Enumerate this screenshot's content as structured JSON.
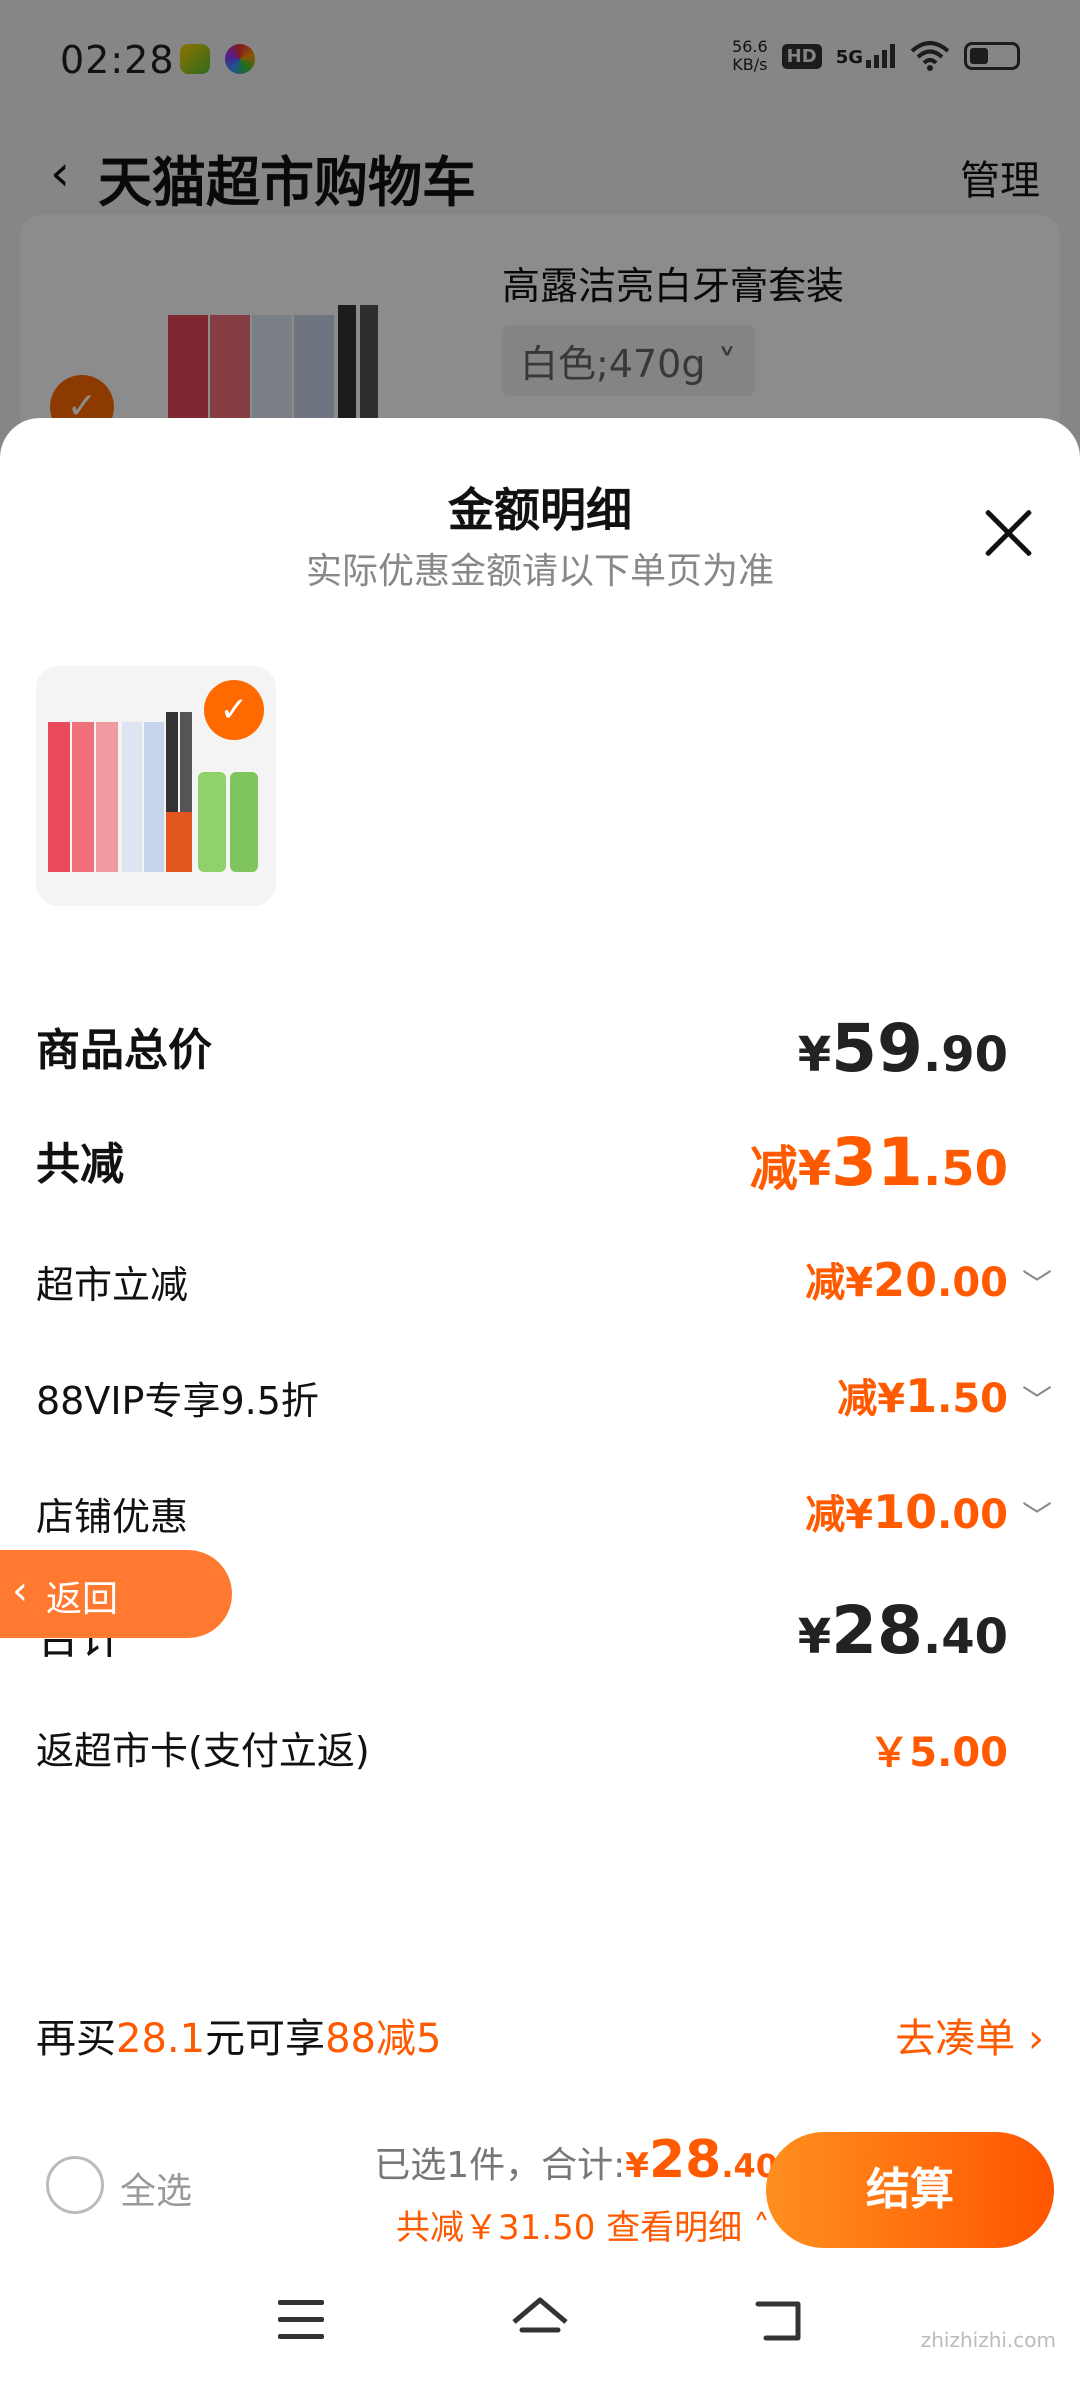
{
  "status_bar": {
    "time": "02:28",
    "net_speed_value": "56.6",
    "net_speed_unit": "KB/s",
    "hd_label": "HD",
    "signal_label": "5G"
  },
  "cart_page": {
    "title": "天猫超市购物车",
    "manage": "管理",
    "item_name": "高露洁亮白牙膏套装",
    "item_spec": "白色;470g ˅"
  },
  "sheet": {
    "title": "金额明细",
    "subtitle": "实际优惠金额请以下单页为准",
    "rows": [
      {
        "label": "商品总价",
        "prefix": "",
        "yen": "¥",
        "int": "59",
        "dec": ".90"
      },
      {
        "label": "共减",
        "prefix": "减",
        "yen": "¥",
        "int": "31",
        "dec": ".50"
      },
      {
        "label": "超市立减",
        "prefix": "减",
        "yen": "¥",
        "int": "20",
        "dec": ".00"
      },
      {
        "label": "88VIP专享9.5折",
        "prefix": "减",
        "yen": "¥",
        "int": "1",
        "dec": ".50"
      },
      {
        "label": "店铺优惠",
        "prefix": "减",
        "yen": "¥",
        "int": "10",
        "dec": ".00"
      },
      {
        "label": "合计",
        "prefix": "",
        "yen": "¥",
        "int": "28",
        "dec": ".40"
      },
      {
        "label": "返超市卡(支付立返)",
        "value": "￥5.00"
      }
    ],
    "back_float": "返回",
    "promo": {
      "p1": "再买",
      "amount": "28.1",
      "p2": "元可享",
      "deal": "88减5",
      "link": "去凑单 ›"
    }
  },
  "bottom_bar": {
    "select_all": "全选",
    "selected_text": "已选1件，合计:",
    "total_yen": "¥",
    "total_int": "28",
    "total_dec": ".40",
    "discount_text": "共减￥31.50",
    "details_link": "查看明细 ˄",
    "checkout": "结算"
  },
  "watermark": "zhizhizhi.com",
  "colors": {
    "accent": "#ff5a00",
    "checkout_gradient_start": "#ff8f1f",
    "checkout_gradient_end": "#ff5500"
  }
}
